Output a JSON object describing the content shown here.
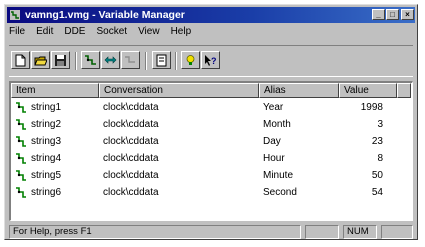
{
  "window": {
    "title": "vamng1.vmg - Variable Manager",
    "controls": {
      "minimize": "_",
      "maximize": "□",
      "close": "×"
    }
  },
  "menu": [
    "File",
    "Edit",
    "DDE",
    "Socket",
    "View",
    "Help"
  ],
  "toolbar": {
    "icons": [
      "new-file-icon",
      "open-folder-icon",
      "save-icon",
      "connect-icon",
      "swap-icon",
      "disconnect-icon",
      "properties-icon",
      "hint-icon",
      "context-help-icon"
    ]
  },
  "list": {
    "columns": [
      "Item",
      "Conversation",
      "Alias",
      "Value"
    ],
    "rows": [
      {
        "item": "string1",
        "conversation": "clock\\cddata",
        "alias": "Year",
        "value": "1998"
      },
      {
        "item": "string2",
        "conversation": "clock\\cddata",
        "alias": "Month",
        "value": "3"
      },
      {
        "item": "string3",
        "conversation": "clock\\cddata",
        "alias": "Day",
        "value": "23"
      },
      {
        "item": "string4",
        "conversation": "clock\\cddata",
        "alias": "Hour",
        "value": "8"
      },
      {
        "item": "string5",
        "conversation": "clock\\cddata",
        "alias": "Minute",
        "value": "50"
      },
      {
        "item": "string6",
        "conversation": "clock\\cddata",
        "alias": "Second",
        "value": "54"
      }
    ]
  },
  "status": {
    "message": "For Help, press F1",
    "pane2": "",
    "num": "NUM",
    "pane4": ""
  },
  "colors": {
    "titlebar": "#0a0a80",
    "chrome": "#c0c0c0",
    "list_bg": "#ffffff",
    "item_icon": "#008000"
  }
}
